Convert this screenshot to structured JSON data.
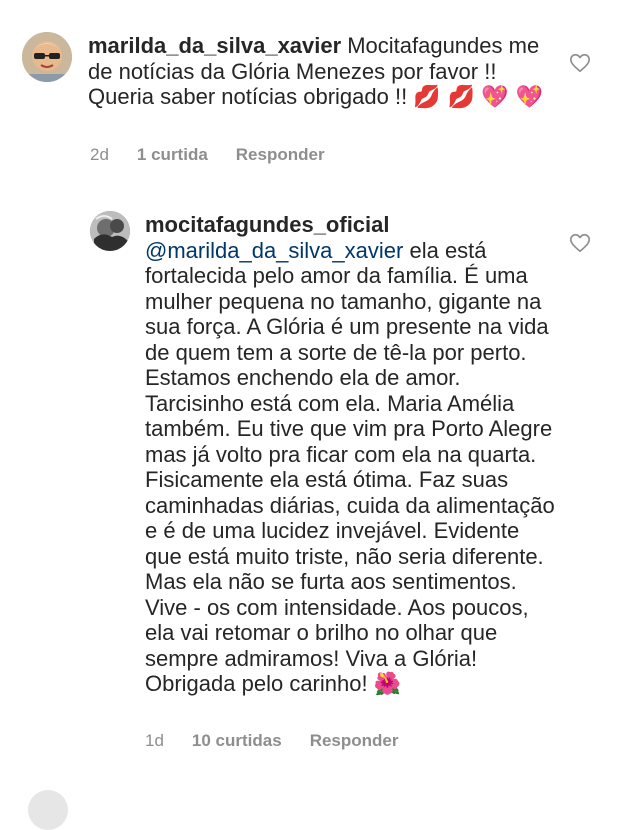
{
  "comments": [
    {
      "username": "marilda_da_silva_xavier",
      "text": "Mocitafagundes me de notícias da Glória Menezes  por favor !! Queria saber notícias  obrigado !!",
      "emojis_inline": "💋 💋",
      "emojis_trailing": "💖 💖",
      "time": "2d",
      "likes": "1 curtida",
      "reply_label": "Responder",
      "avatar_icon": "profile-photo-sunglasses"
    },
    {
      "username": "mocitafagundes_oficial",
      "mention": "@marilda_da_silva_xavier",
      "text": "ela está fortalecida pelo amor da família. É uma mulher pequena no tamanho, gigante na sua força. A Glória é um presente na vida de quem tem a sorte de tê-la por perto. Estamos enchendo ela de amor. Tarcisinho está com ela. Maria Amélia também. Eu tive que vim pra Porto Alegre mas já volto pra ficar com ela na quarta. Fisicamente ela está ótima. Faz suas caminhadas diárias, cuida da alimentação e é de uma lucidez invejável. Evidente que está muito triste, não seria diferente. Mas ela não se furta aos sentimentos. Vive - os com intensidade. Aos poucos, ela vai retomar o brilho no olhar que sempre admiramos! Viva a Glória! Obrigada pelo carinho!",
      "emoji_trailing": "🌺",
      "time": "1d",
      "likes": "10 curtidas",
      "reply_label": "Responder",
      "avatar_icon": "profile-photo-bw"
    }
  ],
  "colors": {
    "text": "#262626",
    "secondary": "#8e8e8e",
    "mention": "#00376b",
    "heart_outline": "#8e8e8e"
  }
}
